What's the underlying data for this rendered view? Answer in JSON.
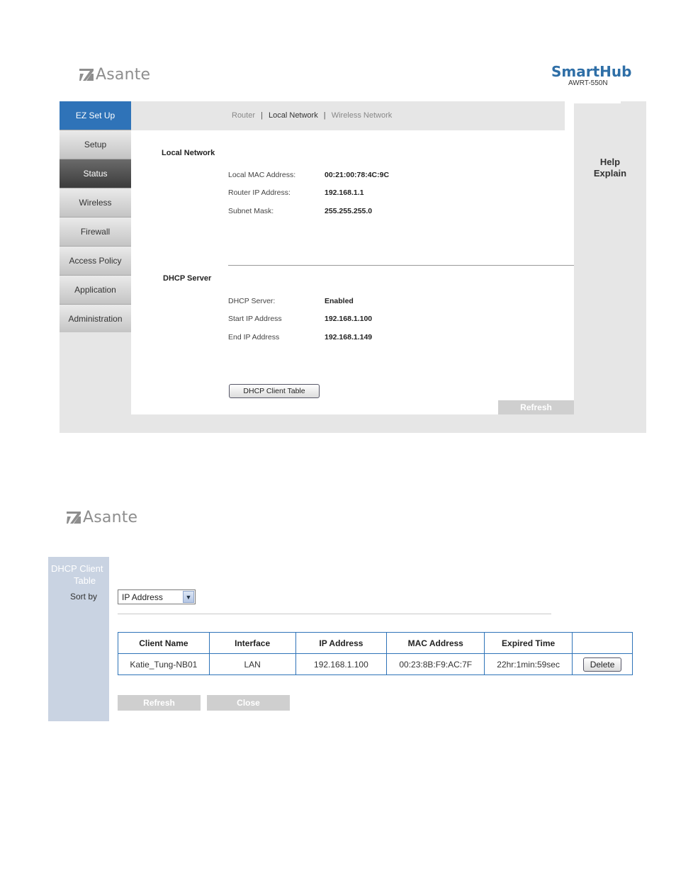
{
  "top": {
    "logo_text": "Asante",
    "brand": {
      "name": "SmartHub",
      "model": "AWRT-550N"
    },
    "nav": [
      "EZ Set Up",
      "Setup",
      "Status",
      "Wireless",
      "Firewall",
      "Access Policy",
      "Application",
      "Administration"
    ],
    "subnav": {
      "router": "Router",
      "sep": "|",
      "local": "Local Network",
      "wireless": "Wireless Network"
    },
    "help": {
      "line1": "Help",
      "line2": "Explain"
    },
    "local_network": {
      "title": "Local Network",
      "rows": [
        {
          "label": "Local MAC Address:",
          "value": "00:21:00:78:4C:9C"
        },
        {
          "label": "Router IP Address:",
          "value": "192.168.1.1"
        },
        {
          "label": "Subnet Mask:",
          "value": "255.255.255.0"
        }
      ]
    },
    "dhcp_server": {
      "title": "DHCP Server",
      "rows": [
        {
          "label": "DHCP Server:",
          "value": "Enabled"
        },
        {
          "label": "Start IP Address",
          "value": "192.168.1.100"
        },
        {
          "label": "End IP Address",
          "value": "192.168.1.149"
        }
      ]
    },
    "dhcp_client_table_button": "DHCP Client Table",
    "refresh_button": "Refresh"
  },
  "bottom": {
    "logo_text": "Asante",
    "panel_title_line1": "DHCP Client",
    "panel_title_line2": "Table",
    "sort_label": "Sort by",
    "sort_value": "IP Address",
    "columns": [
      "Client Name",
      "Interface",
      "IP Address",
      "MAC Address",
      "Expired Time",
      ""
    ],
    "rows": [
      {
        "client_name": "Katie_Tung-NB01",
        "interface": "LAN",
        "ip": "192.168.1.100",
        "mac": "00:23:8B:F9:AC:7F",
        "expired": "22hr:1min:59sec",
        "action": "Delete"
      }
    ],
    "refresh_button": "Refresh",
    "close_button": "Close"
  },
  "colors": {
    "accent": "#2f73b8",
    "brand": "#2f6fa7",
    "panel": "#c9d3e2",
    "gray": "#e6e6e6"
  }
}
